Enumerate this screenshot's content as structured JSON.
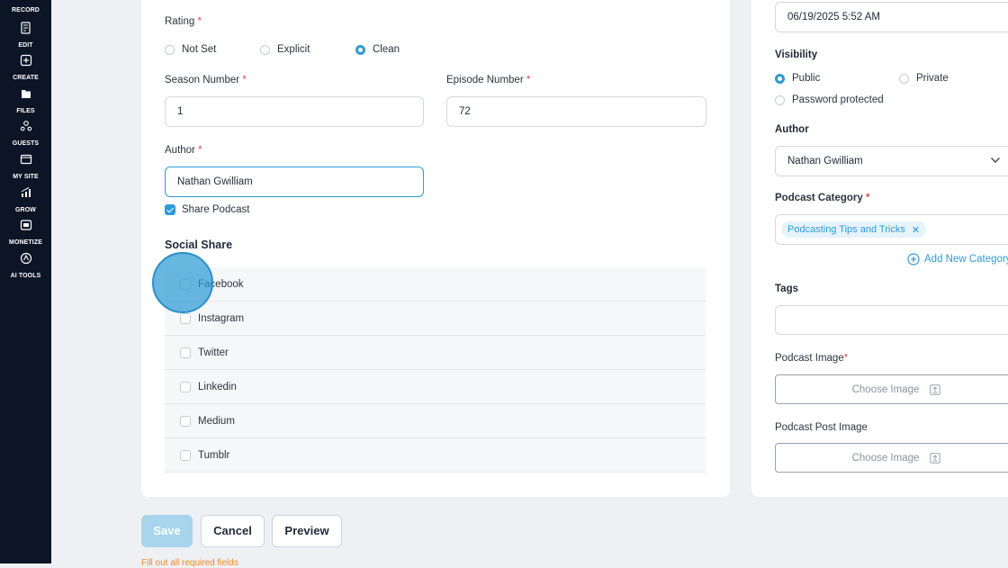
{
  "sidebar": {
    "items": [
      {
        "label": "RECORD",
        "icon": "mic-icon"
      },
      {
        "label": "EDIT",
        "icon": "edit-icon"
      },
      {
        "label": "CREATE",
        "icon": "create-icon"
      },
      {
        "label": "FILES",
        "icon": "files-icon"
      },
      {
        "label": "GUESTS",
        "icon": "guests-icon"
      },
      {
        "label": "MY SITE",
        "icon": "site-icon"
      },
      {
        "label": "GROW",
        "icon": "grow-icon"
      },
      {
        "label": "MONETIZE",
        "icon": "monetize-icon"
      },
      {
        "label": "AI TOOLS",
        "icon": "ai-icon"
      }
    ]
  },
  "form": {
    "rating": {
      "label": "Rating",
      "options": [
        "Not Set",
        "Explicit",
        "Clean"
      ],
      "selected": "Clean"
    },
    "season": {
      "label": "Season Number",
      "value": "1"
    },
    "episode": {
      "label": "Episode Number",
      "value": "72"
    },
    "author": {
      "label": "Author",
      "value": "Nathan Gwilliam"
    },
    "share_podcast": {
      "label": "Share Podcast",
      "checked": true
    },
    "social": {
      "title": "Social Share",
      "items": [
        "Facebook",
        "Instagram",
        "Twitter",
        "Linkedin",
        "Medium",
        "Tumblr"
      ]
    },
    "required_mark": "*"
  },
  "right": {
    "datetime": "06/19/2025 5:52 AM",
    "visibility": {
      "label": "Visibility",
      "options": [
        "Public",
        "Private",
        "Password protected"
      ],
      "selected": "Public"
    },
    "author": {
      "label": "Author",
      "value": "Nathan Gwilliam"
    },
    "category": {
      "label": "Podcast Category",
      "chip": "Podcasting Tips and Tricks",
      "add_label": "Add New Category"
    },
    "tags": {
      "label": "Tags"
    },
    "podcast_image": {
      "label": "Podcast Image",
      "button": "Choose Image"
    },
    "post_image": {
      "label": "Podcast Post Image",
      "button": "Choose Image"
    }
  },
  "actions": {
    "save": "Save",
    "cancel": "Cancel",
    "preview": "Preview",
    "error": "Fill out all required fields"
  },
  "colors": {
    "accent": "#2e9bd6",
    "sidebar": "#0b1526",
    "required": "#e5484d",
    "warning": "#f08a24"
  }
}
